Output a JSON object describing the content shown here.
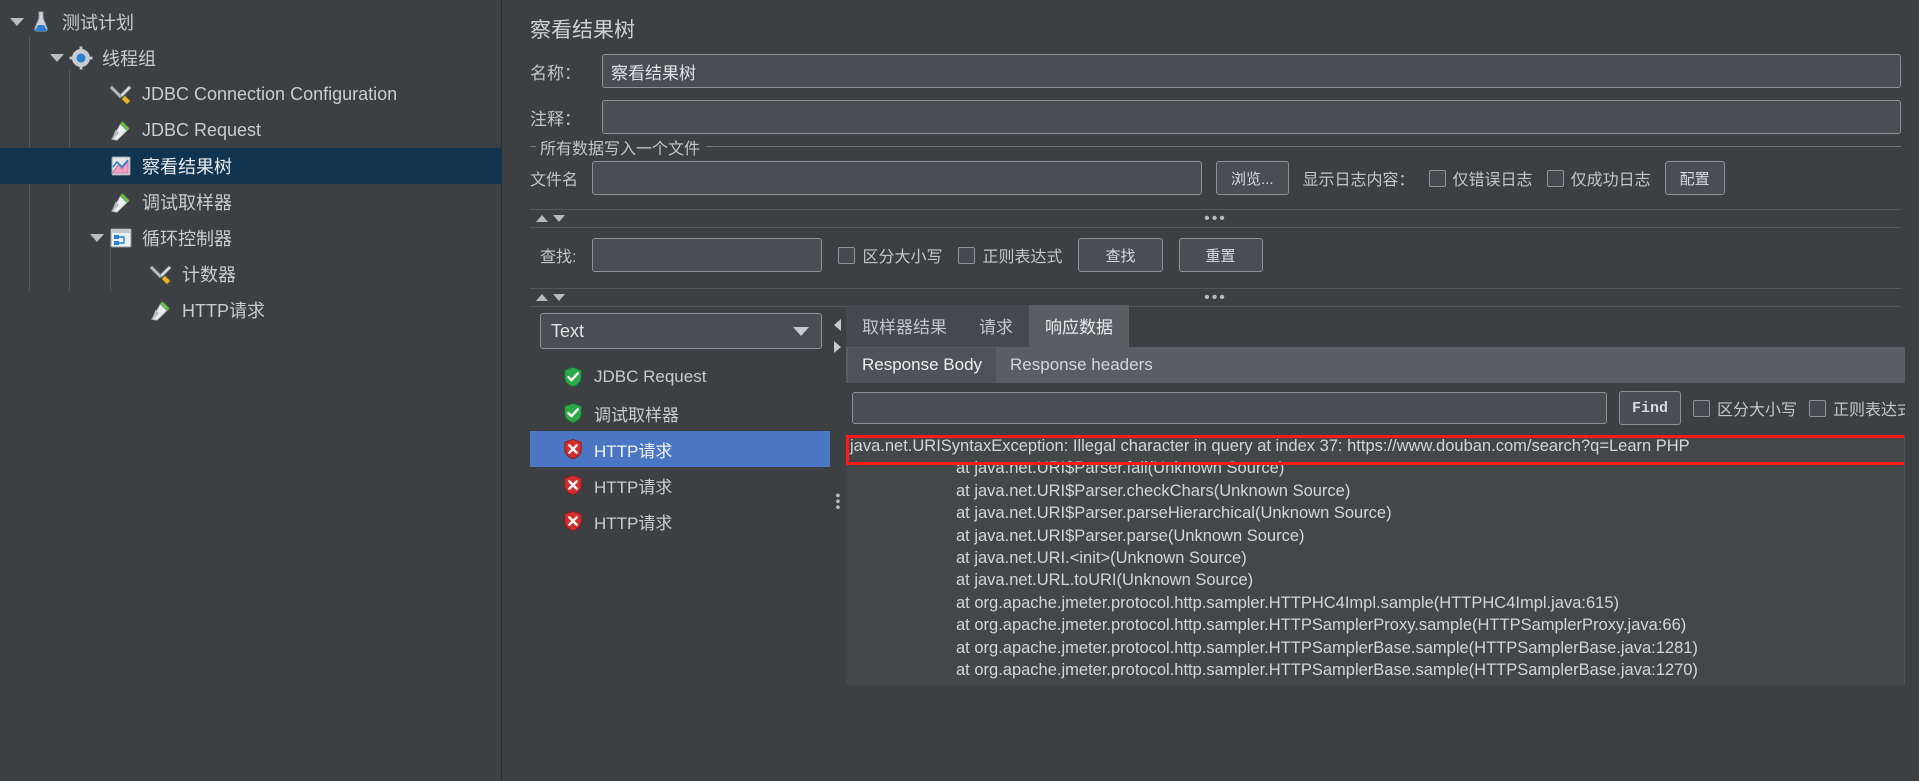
{
  "tree": {
    "items": [
      {
        "label": "测试计划",
        "icon": "flask-icon",
        "depth": 0,
        "toggle": true,
        "selected": false
      },
      {
        "label": "线程组",
        "icon": "gear-icon",
        "depth": 1,
        "toggle": true,
        "selected": false
      },
      {
        "label": "JDBC Connection Configuration",
        "icon": "tools-icon",
        "depth": 2,
        "toggle": false,
        "selected": false
      },
      {
        "label": "JDBC Request",
        "icon": "pipette-icon",
        "depth": 2,
        "toggle": false,
        "selected": false
      },
      {
        "label": "察看结果树",
        "icon": "chart-icon",
        "depth": 2,
        "toggle": false,
        "selected": true
      },
      {
        "label": "调试取样器",
        "icon": "pipette-icon",
        "depth": 2,
        "toggle": false,
        "selected": false
      },
      {
        "label": "循环控制器",
        "icon": "controller-icon",
        "depth": 2,
        "toggle": true,
        "selected": false
      },
      {
        "label": "计数器",
        "icon": "tools-icon",
        "depth": 3,
        "toggle": false,
        "selected": false
      },
      {
        "label": "HTTP请求",
        "icon": "pipette-icon",
        "depth": 3,
        "toggle": false,
        "selected": false
      }
    ]
  },
  "panel": {
    "title": "察看结果树",
    "name_label": "名称：",
    "name_value": "察看结果树",
    "comment_label": "注释：",
    "comment_value": "",
    "group_legend": "所有数据写入一个文件",
    "filename_label": "文件名",
    "filename_value": "",
    "browse_button": "浏览...",
    "log_display_label": "显示日志内容：",
    "errors_only_label": "仅错误日志",
    "success_only_label": "仅成功日志",
    "configure_button": "配置"
  },
  "search": {
    "label": "查找:",
    "value": "",
    "case_sensitive_label": "区分大小写",
    "regex_label": "正则表达式",
    "find_button": "查找",
    "reset_button": "重置"
  },
  "results": {
    "renderer_selected": "Text",
    "items": [
      {
        "label": "JDBC Request",
        "status": "success",
        "selected": false
      },
      {
        "label": "调试取样器",
        "status": "success",
        "selected": false
      },
      {
        "label": "HTTP请求",
        "status": "error",
        "selected": true
      },
      {
        "label": "HTTP请求",
        "status": "error",
        "selected": false
      },
      {
        "label": "HTTP请求",
        "status": "error",
        "selected": false
      }
    ],
    "tabs": [
      {
        "label": "取样器结果",
        "active": false
      },
      {
        "label": "请求",
        "active": false
      },
      {
        "label": "响应数据",
        "active": true
      }
    ],
    "subtabs": [
      {
        "label": "Response Body",
        "active": true
      },
      {
        "label": "Response headers",
        "active": false
      }
    ],
    "find": {
      "value": "",
      "button": "Find",
      "case_sensitive_label": "区分大小写",
      "regex_label": "正则表达式"
    },
    "response_lines": [
      "java.net.URISyntaxException: Illegal character in query at index 37: https://www.douban.com/search?q=Learn PHP",
      "at java.net.URI$Parser.fail(Unknown Source)",
      "at java.net.URI$Parser.checkChars(Unknown Source)",
      "at java.net.URI$Parser.parseHierarchical(Unknown Source)",
      "at java.net.URI$Parser.parse(Unknown Source)",
      "at java.net.URI.<init>(Unknown Source)",
      "at java.net.URL.toURI(Unknown Source)",
      "at org.apache.jmeter.protocol.http.sampler.HTTPHC4Impl.sample(HTTPHC4Impl.java:615)",
      "at org.apache.jmeter.protocol.http.sampler.HTTPSamplerProxy.sample(HTTPSamplerProxy.java:66)",
      "at org.apache.jmeter.protocol.http.sampler.HTTPSamplerBase.sample(HTTPSamplerBase.java:1281)",
      "at org.apache.jmeter.protocol.http.sampler.HTTPSamplerBase.sample(HTTPSamplerBase.java:1270)"
    ]
  },
  "colors": {
    "accent_selection": "#113450",
    "list_selection": "#4a76c4",
    "highlight_border": "#ff1a1a",
    "success": "#27a844",
    "error": "#d93025"
  }
}
